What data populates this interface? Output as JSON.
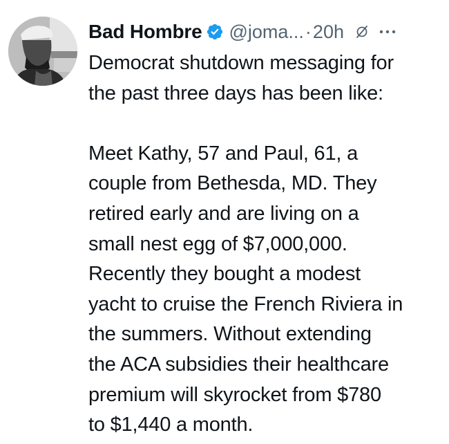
{
  "author": {
    "display_name": "Bad Hombre",
    "handle": "@joma...",
    "separator": "·",
    "time": "20h",
    "verified_icon": "verified-badge-icon",
    "avatar": "avatar-photo"
  },
  "actions": {
    "grok_icon": "grok-slash-circle-icon",
    "more_icon": "more-options-icon"
  },
  "tweet": {
    "paragraphs": [
      [
        "Democrat shutdown messaging for",
        "the past three days has been like:"
      ],
      [
        "Meet Kathy, 57 and Paul, 61, a",
        "couple from Bethesda, MD. They",
        "retired early and are living on a",
        "small nest egg of $7,000,000.",
        "Recently they bought a modest",
        "yacht to cruise the French Riviera in",
        "the summers. Without extending",
        "the ACA subsidies their healthcare",
        "premium will skyrocket from $780",
        "to $1,440 a month."
      ]
    ]
  },
  "colors": {
    "text": "#0f1419",
    "secondary": "#536471",
    "verified": "#1d9bf0"
  }
}
